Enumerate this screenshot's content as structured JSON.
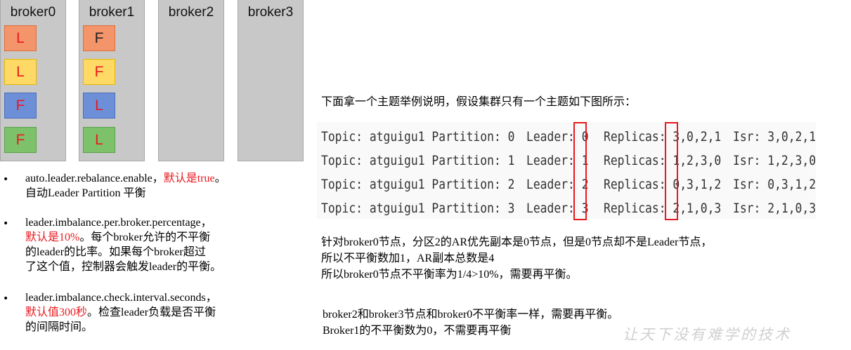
{
  "brokers": [
    {
      "name": "broker0",
      "partitions": [
        {
          "label": "L",
          "fill": "#f4946b",
          "border": "#d9703f"
        },
        {
          "label": "L",
          "fill": "#ffd966",
          "border": "#e6b800"
        },
        {
          "label": "F",
          "fill": "#6d8fd8",
          "border": "#4a6ebc"
        },
        {
          "label": "F",
          "fill": "#7dc16b",
          "border": "#5aa04a"
        }
      ]
    },
    {
      "name": "broker1",
      "partitions": [
        {
          "label": "F",
          "fill": "#f4946b",
          "border": "#d9703f"
        },
        {
          "label": "F",
          "fill": "#ffd966",
          "border": "#e6b800"
        },
        {
          "label": "L",
          "fill": "#6d8fd8",
          "border": "#4a6ebc"
        },
        {
          "label": "L",
          "fill": "#7dc16b",
          "border": "#5aa04a"
        }
      ]
    },
    {
      "name": "broker2",
      "partitions": []
    },
    {
      "name": "broker3",
      "partitions": []
    }
  ],
  "label_color": "#e8191f",
  "bullets": [
    {
      "lines": [
        [
          {
            "t": "auto.leader.rebalance.enable，",
            "red": false
          },
          {
            "t": "默认是true",
            "red": true
          },
          {
            "t": "。",
            "red": false
          }
        ],
        [
          {
            "t": "自动Leader Partition 平衡",
            "red": false
          }
        ]
      ]
    },
    {
      "lines": [
        [
          {
            "t": "leader.imbalance.per.broker.percentage，",
            "red": false
          }
        ],
        [
          {
            "t": "默认是10%",
            "red": true
          },
          {
            "t": "。每个broker允许的不平衡",
            "red": false
          }
        ],
        [
          {
            "t": "的leader的比率。如果每个broker超过",
            "red": false
          }
        ],
        [
          {
            "t": "了这个值，控制器会触发leader的平衡。",
            "red": false
          }
        ]
      ]
    },
    {
      "lines": [
        [
          {
            "t": "leader.imbalance.check.interval.seconds，",
            "red": false
          }
        ],
        [
          {
            "t": "默认值300秒",
            "red": true
          },
          {
            "t": "。检查leader负载是否平衡",
            "red": false
          }
        ],
        [
          {
            "t": "的间隔时间。",
            "red": false
          }
        ]
      ]
    }
  ],
  "intro": "下面拿一个主题举例说明，假设集群只有一个主题如下图所示：",
  "topic_rows": [
    {
      "topic": "Topic: atguigu1 Partition: 0",
      "leader": "Leader: 0",
      "replicas": "Replicas: 3,0,2,1",
      "isr": "Isr: 3,0,2,1"
    },
    {
      "topic": "Topic: atguigu1 Partition: 1",
      "leader": "Leader: 1",
      "replicas": "Replicas: 1,2,3,0",
      "isr": "Isr: 1,2,3,0"
    },
    {
      "topic": "Topic: atguigu1 Partition: 2",
      "leader": "Leader: 2",
      "replicas": "Replicas: 0,3,1,2",
      "isr": "Isr: 0,3,1,2"
    },
    {
      "topic": "Topic: atguigu1 Partition: 3",
      "leader": "Leader: 3",
      "replicas": "Replicas: 2,1,0,3",
      "isr": "Isr: 2,1,0,3"
    }
  ],
  "analysis": [
    "针对broker0节点，分区2的AR优先副本是0节点，但是0节点却不是Leader节点，",
    "所以不平衡数加1，AR副本总数是4",
    "所以broker0节点不平衡率为1/4>10%，需要再平衡。"
  ],
  "conclusion": [
    "broker2和broker3节点和broker0不平衡率一样，需要再平衡。",
    "Broker1的不平衡数为0，不需要再平衡"
  ],
  "watermark": "让天下没有难学的技术"
}
